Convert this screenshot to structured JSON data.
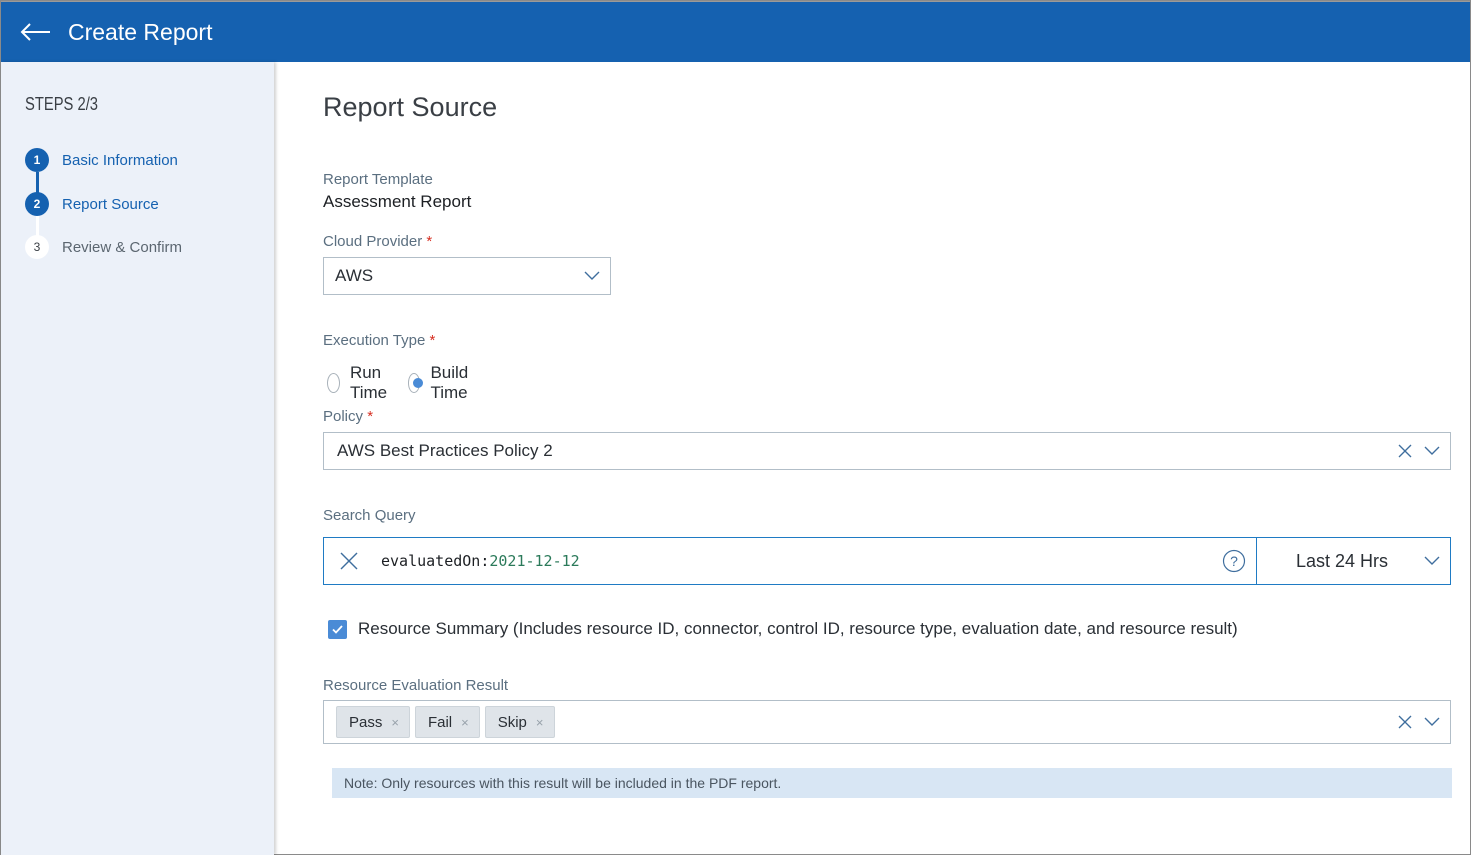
{
  "header": {
    "title": "Create Report",
    "back_icon": "arrow-left-icon"
  },
  "sidebar": {
    "steps_title": "STEPS 2/3",
    "steps": [
      {
        "number": "1",
        "label": "Basic Information",
        "state": "completed"
      },
      {
        "number": "2",
        "label": "Report Source",
        "state": "active"
      },
      {
        "number": "3",
        "label": "Review & Confirm",
        "state": "pending"
      }
    ]
  },
  "main": {
    "title": "Report Source",
    "report_template": {
      "label": "Report Template",
      "value": "Assessment Report"
    },
    "cloud_provider": {
      "label": "Cloud Provider",
      "required_mark": "*",
      "value": "AWS"
    },
    "execution_type": {
      "label": "Execution Type",
      "required_mark": "*",
      "options": [
        {
          "label": "Run Time",
          "checked": false
        },
        {
          "label": "Build Time",
          "checked": true
        }
      ]
    },
    "policy": {
      "label": "Policy",
      "required_mark": "*",
      "value": "AWS Best Practices Policy 2"
    },
    "search_query": {
      "label": "Search Query",
      "key": "evaluatedOn:",
      "value": "2021-12-12",
      "time_range": "Last 24 Hrs"
    },
    "resource_summary": {
      "checked": true,
      "label": "Resource Summary (Includes resource ID, connector, control ID, resource type, evaluation date, and resource result)"
    },
    "resource_evaluation_result": {
      "label": "Resource Evaluation Result",
      "chips": [
        "Pass",
        "Fail",
        "Skip"
      ],
      "chip_remove_glyph": "×"
    },
    "note": "Note: Only resources with this result will be included in the PDF report."
  },
  "colors": {
    "brand": "#1561b0",
    "sidebar_bg": "#ecf1f9",
    "accent": "#4a8bd6",
    "required": "#d62d20",
    "note_bg": "#d8e6f4"
  }
}
